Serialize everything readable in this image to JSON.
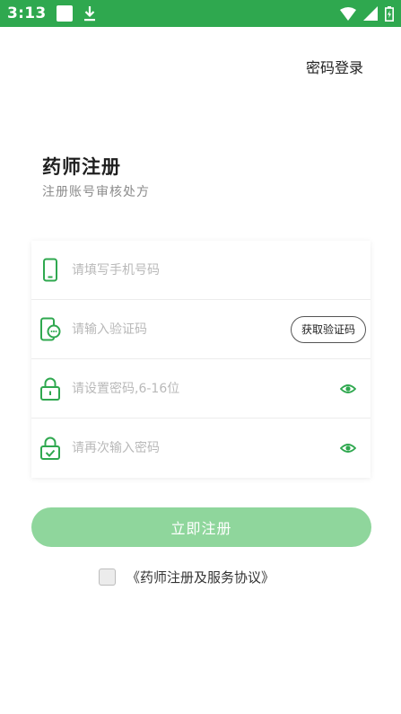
{
  "status_bar": {
    "time": "3:13"
  },
  "header": {
    "password_login_link": "密码登录"
  },
  "title": {
    "heading": "药师注册",
    "subtitle": "注册账号审核处方"
  },
  "form": {
    "phone_placeholder": "请填写手机号码",
    "code_placeholder": "请输入验证码",
    "get_code_label": "获取验证码",
    "password_placeholder": "请设置密码,6-16位",
    "confirm_placeholder": "请再次输入密码"
  },
  "actions": {
    "register_label": "立即注册"
  },
  "agreement": {
    "text": "《药师注册及服务协议》",
    "checked": false
  },
  "colors": {
    "status_bar": "#2fa84f",
    "accent": "#2fa84f",
    "button_disabled": "#8fd69c"
  },
  "icons": {
    "phone": "phone-icon",
    "code": "message-code-icon",
    "password": "lock-icon",
    "confirm": "lock-check-icon",
    "show_password": "eye-icon"
  }
}
